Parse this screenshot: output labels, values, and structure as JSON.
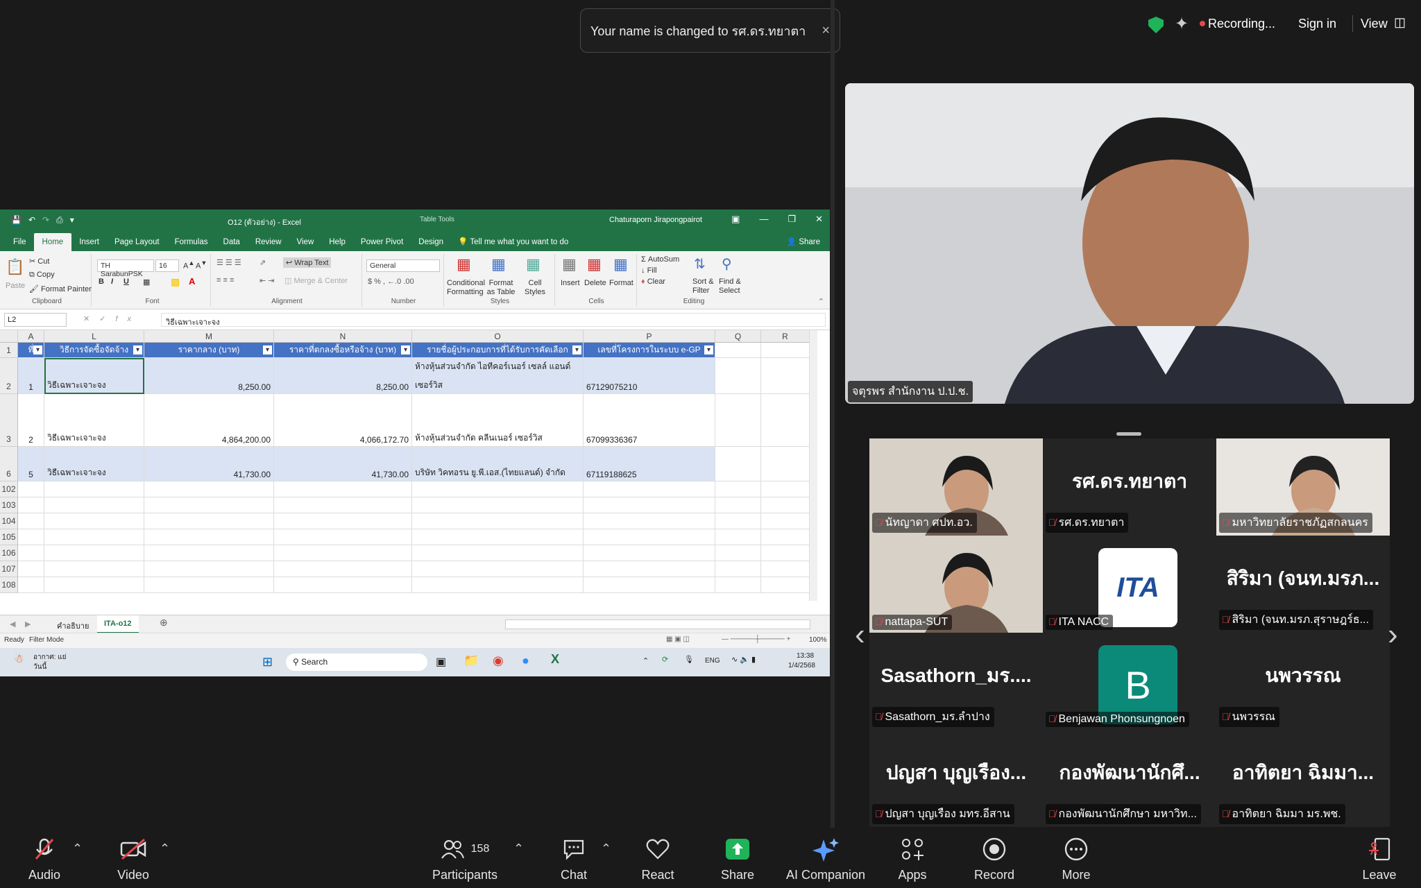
{
  "toast": {
    "message": "Your name is changed to รศ.ดร.ทยาตา",
    "close": "×"
  },
  "topbar": {
    "recording": "Recording...",
    "sign_in": "Sign in",
    "view": "View"
  },
  "excel": {
    "filename": "O12 (ตัวอย่าง) - Excel",
    "table_tools": "Table Tools",
    "user": "Chaturaporn Jirapongpairot",
    "tabs": [
      "File",
      "Home",
      "Insert",
      "Page Layout",
      "Formulas",
      "Data",
      "Review",
      "View",
      "Help",
      "Power Pivot",
      "Design"
    ],
    "tell_me": "Tell me what you want to do",
    "share": "Share",
    "ribbon": {
      "paste": "Paste",
      "cut": "Cut",
      "copy": "Copy",
      "format_painter": "Format Painter",
      "clipboard": "Clipboard",
      "font_name": "TH SarabunPSK",
      "font_size": "16",
      "font": "Font",
      "wrap_text": "Wrap Text",
      "merge_center": "Merge & Center",
      "alignment": "Alignment",
      "number_format": "General",
      "number": "Number",
      "conditional": "Conditional Formatting",
      "format_table": "Format as Table",
      "cell_styles": "Cell Styles",
      "styles": "Styles",
      "insert": "Insert",
      "delete": "Delete",
      "format": "Format",
      "cells": "Cells",
      "autosum": "AutoSum",
      "fill": "Fill",
      "clear": "Clear",
      "sort_filter": "Sort & Filter",
      "find_select": "Find & Select",
      "editing": "Editing"
    },
    "name_box": "L2",
    "formula": "วิธีเฉพาะเจาะจง",
    "columns": [
      "A",
      "L",
      "M",
      "N",
      "O",
      "P",
      "Q",
      "R"
    ],
    "headers": [
      "ที่",
      "วิธีการจัดซื้อจัดจ้าง",
      "ราคากลาง (บาท)",
      "ราคาที่ตกลงซื้อหรือจ้าง (บาท)",
      "รายชื่อผู้ประกอบการที่ได้รับการคัดเลือก",
      "เลขที่โครงการในระบบ e-GP"
    ],
    "rows": [
      {
        "row": "2",
        "a": "1",
        "l": "วิธีเฉพาะเจาะจง",
        "m": "8,250.00",
        "n": "8,250.00",
        "o1": "ห้างหุ้นส่วนจำกัด ไอทีคอร์เนอร์ เซลล์ แอนด์",
        "o2": "เซอร์วิส",
        "p": "67129075210"
      },
      {
        "row": "3",
        "a": "2",
        "l": "วิธีเฉพาะเจาะจง",
        "m": "4,864,200.00",
        "n": "4,066,172.70",
        "o1": "",
        "o2": "ห้างหุ้นส่วนจำกัด คลีนเนอร์ เซอร์วิส",
        "p": "67099336367"
      },
      {
        "row": "6",
        "a": "5",
        "l": "วิธีเฉพาะเจาะจง",
        "m": "41,730.00",
        "n": "41,730.00",
        "o1": "",
        "o2": "บริษัท วิคทอรน ยู.พี.เอส.(ไทยแลนด์) จำกัด",
        "p": "67119188625"
      }
    ],
    "empty_rows": [
      "102",
      "103",
      "104",
      "105",
      "106",
      "107",
      "108"
    ],
    "row1": "1",
    "sheets": [
      "คำอธิบาย",
      "ITA-o12"
    ],
    "status_ready": "Ready",
    "status_filter": "Filter Mode",
    "zoom": "100%",
    "taskbar": {
      "weather": "อากาศ: แย่",
      "weather_sub": "วันนี้",
      "search": "Search",
      "lang": "ENG",
      "time": "13:38",
      "date": "1/4/2568"
    }
  },
  "speaker": {
    "name": "จตุรพร สำนักงาน ป.ป.ช."
  },
  "gallery": [
    {
      "big": "",
      "label": "นัทญาดา ศปท.อว.",
      "video": true
    },
    {
      "big": "รศ.ดร.ทยาตา",
      "label": "รศ.ดร.ทยาตา",
      "video": false
    },
    {
      "big": "",
      "label": "มหาวิทยาลัยราชภัฏสกลนคร",
      "video": true
    },
    {
      "big": "",
      "label": "nattapa-SUT",
      "video": true
    },
    {
      "big": "ITA",
      "label": "ITA NACC",
      "video": false
    },
    {
      "big": "สิริมา (จนท.มรภ...",
      "label": "สิริมา (จนท.มรภ.สุราษฎร์ธ...",
      "video": false
    },
    {
      "big": "Sasathorn_มร....",
      "label": "Sasathorn_มร.ลำปาง",
      "video": false
    },
    {
      "big": "B",
      "label": "Benjawan Phonsungnoen",
      "video": false
    },
    {
      "big": "นพวรรณ",
      "label": "นพวรรณ",
      "video": false
    },
    {
      "big": "ปญสา บุญเรือง...",
      "label": "ปญสา บุญเรือง มทร.อีสาน",
      "video": false
    },
    {
      "big": "กองพัฒนานักศึ...",
      "label": "กองพัฒนานักศึกษา มหาวิท...",
      "video": false
    },
    {
      "big": "อาทิตยา ฉิมมา...",
      "label": "อาทิตยา ฉิมมา มร.พช.",
      "video": false
    }
  ],
  "bottombar": {
    "audio": "Audio",
    "video": "Video",
    "participants": "Participants",
    "participant_count": "158",
    "chat": "Chat",
    "react": "React",
    "share": "Share",
    "ai": "AI Companion",
    "apps": "Apps",
    "record": "Record",
    "more": "More",
    "leave": "Leave"
  },
  "colors": {
    "excel_green": "#217346",
    "table_header": "#4472c4",
    "band": "#dae3f3",
    "share_green": "#1fb35a",
    "mute_red": "#e5484d"
  }
}
